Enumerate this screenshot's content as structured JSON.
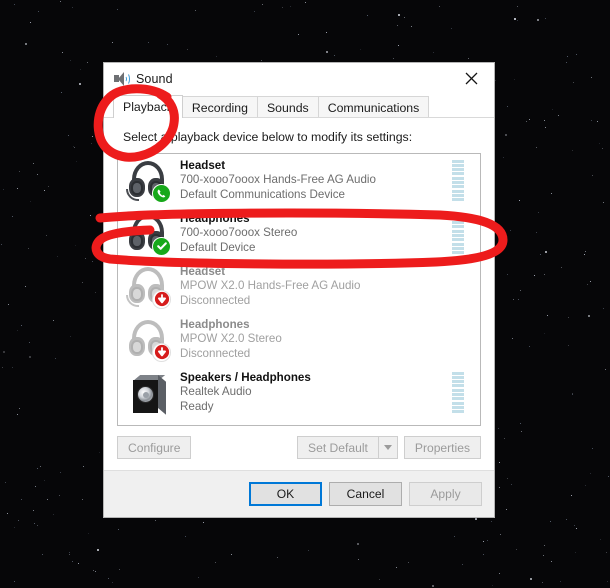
{
  "window": {
    "title": "Sound",
    "title_icon": "speaker-icon",
    "close_icon": "close-icon"
  },
  "tabs": [
    {
      "label": "Playback",
      "active": true
    },
    {
      "label": "Recording",
      "active": false
    },
    {
      "label": "Sounds",
      "active": false
    },
    {
      "label": "Communications",
      "active": false
    }
  ],
  "playback": {
    "hint": "Select a playback device below to modify its settings:",
    "devices": [
      {
        "name": "Headset",
        "subtitle": "700-xooo7ooox Hands-Free AG Audio",
        "status": "Default Communications Device",
        "icon": "headset-icon",
        "badge": "phone-badge-icon",
        "badge_type": "green-phone",
        "disabled": false,
        "meter_segments": 10,
        "meter_active": true
      },
      {
        "name": "Headphones",
        "subtitle": "700-xooo7ooox Stereo",
        "status": "Default Device",
        "icon": "headphones-icon",
        "badge": "check-badge-icon",
        "badge_type": "green-check",
        "disabled": false,
        "meter_segments": 10,
        "meter_active": true
      },
      {
        "name": "Headset",
        "subtitle": "MPOW X2.0 Hands-Free AG Audio",
        "status": "Disconnected",
        "icon": "headset-icon",
        "badge": "disconnected-badge-icon",
        "badge_type": "red-down-arrow",
        "disabled": true,
        "meter_segments": 10,
        "meter_active": false
      },
      {
        "name": "Headphones",
        "subtitle": "MPOW X2.0 Stereo",
        "status": "Disconnected",
        "icon": "headphones-icon",
        "badge": "disconnected-badge-icon",
        "badge_type": "red-down-arrow",
        "disabled": true,
        "meter_segments": 10,
        "meter_active": false
      },
      {
        "name": "Speakers / Headphones",
        "subtitle": "Realtek Audio",
        "status": "Ready",
        "icon": "speaker-box-icon",
        "badge": "",
        "badge_type": "none",
        "disabled": false,
        "meter_segments": 10,
        "meter_active": true
      }
    ]
  },
  "actions": {
    "configure": {
      "label": "Configure",
      "enabled": false
    },
    "set_default": {
      "label": "Set Default",
      "enabled": false
    },
    "set_default_caret": "chevron-down-icon",
    "properties": {
      "label": "Properties",
      "enabled": false
    }
  },
  "footer": {
    "ok": {
      "label": "OK",
      "default": true,
      "enabled": true
    },
    "cancel": {
      "label": "Cancel",
      "enabled": true
    },
    "apply": {
      "label": "Apply",
      "enabled": false
    }
  },
  "annotations": {
    "color": "#ed1c1c",
    "shapes": [
      {
        "name": "playback-tab-circle",
        "kind": "ellipse"
      },
      {
        "name": "headphones-row-oval",
        "kind": "ellipse"
      }
    ]
  },
  "colors": {
    "accent": "#0078d7",
    "badge_green": "#17a81a",
    "badge_red": "#d61c1c",
    "meter": "#c3dfe9",
    "annotation_red": "#ed1c1c",
    "window_bg": "#f0f0f0",
    "desktop_bg": "#060608"
  }
}
